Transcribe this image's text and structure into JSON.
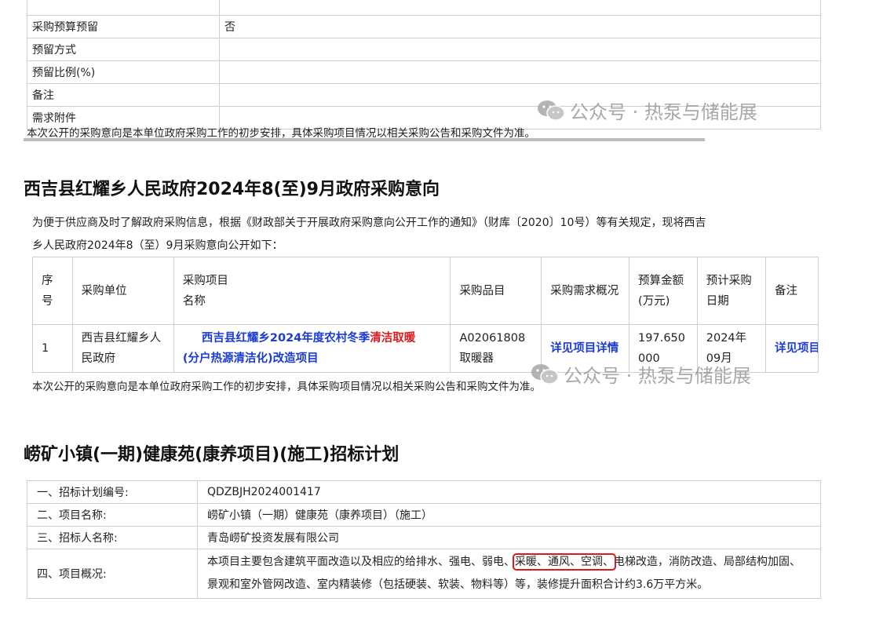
{
  "block1": {
    "rows": [
      {
        "label": "采购预算预留",
        "value": "否"
      },
      {
        "label": "预留方式",
        "value": ""
      },
      {
        "label": "预留比例(%)",
        "value": ""
      },
      {
        "label": "备注",
        "value": ""
      },
      {
        "label": "需求附件",
        "value": ""
      }
    ],
    "note": "本次公开的采购意向是本单位政府采购工作的初步安排，具体采购项目情况以相关采购公告和采购文件为准。"
  },
  "block2": {
    "title": "西吉县红耀乡人民政府2024年8(至)9月政府采购意向",
    "intro_line1": "为便于供应商及时了解政府采购信息，根据《财政部关于开展政府采购意向公开工作的通知》（财库〔2020〕10号）等有关规定，现将西吉",
    "intro_line2": "乡人民政府2024年8（至）9月采购意向公开如下：",
    "headers": {
      "no": "序号",
      "unit": "采购单位",
      "project_a": "采购项目",
      "project_b": "名称",
      "item": "采购品目",
      "need": "采购需求概况",
      "budget": "预算金额(万元)",
      "date": "预计采购日期",
      "remark": "备注"
    },
    "row": {
      "no": "1",
      "unit": "西吉县红耀乡人民政府",
      "project_pre": "西吉县红耀乡2024年度农村冬季",
      "project_red": "清洁取暖",
      "project_post": "(分户热源清洁化)改造项目",
      "item_code": "A02061808",
      "item_name": "取暖器",
      "need": "详见项目详情",
      "budget": "197.650000",
      "date": "2024年09月",
      "remark": "详见项目详情"
    },
    "note": "本次公开的采购意向是本单位政府采购工作的初步安排，具体采购项目情况以相关采购公告和采购文件为准。"
  },
  "block3": {
    "title": "崂矿小镇(一期)健康苑(康养项目)(施工)招标计划",
    "rows": [
      {
        "label": "一、招标计划编号:",
        "value": "QDZBJH2024001417"
      },
      {
        "label": "二、项目名称:",
        "value": "崂矿小镇（一期）健康苑（康养项目）（施工）"
      },
      {
        "label": "三、招标人名称:",
        "value": "青岛崂矿投资发展有限公司"
      }
    ],
    "overview_label": "四、项目概况:",
    "overview_pre": "本项目主要包含建筑平面改造以及相应的给排水、强电、弱电、",
    "overview_hl": "采暖、通风、空调、",
    "overview_post": "电梯改造，消防改造、局部结构加固、景观和室外管网改造、室内精装修（包括硬装、软装、物料等）等，装修提升面积合计约3.6万平方米。"
  },
  "watermark": "公众号 · 热泵与储能展"
}
